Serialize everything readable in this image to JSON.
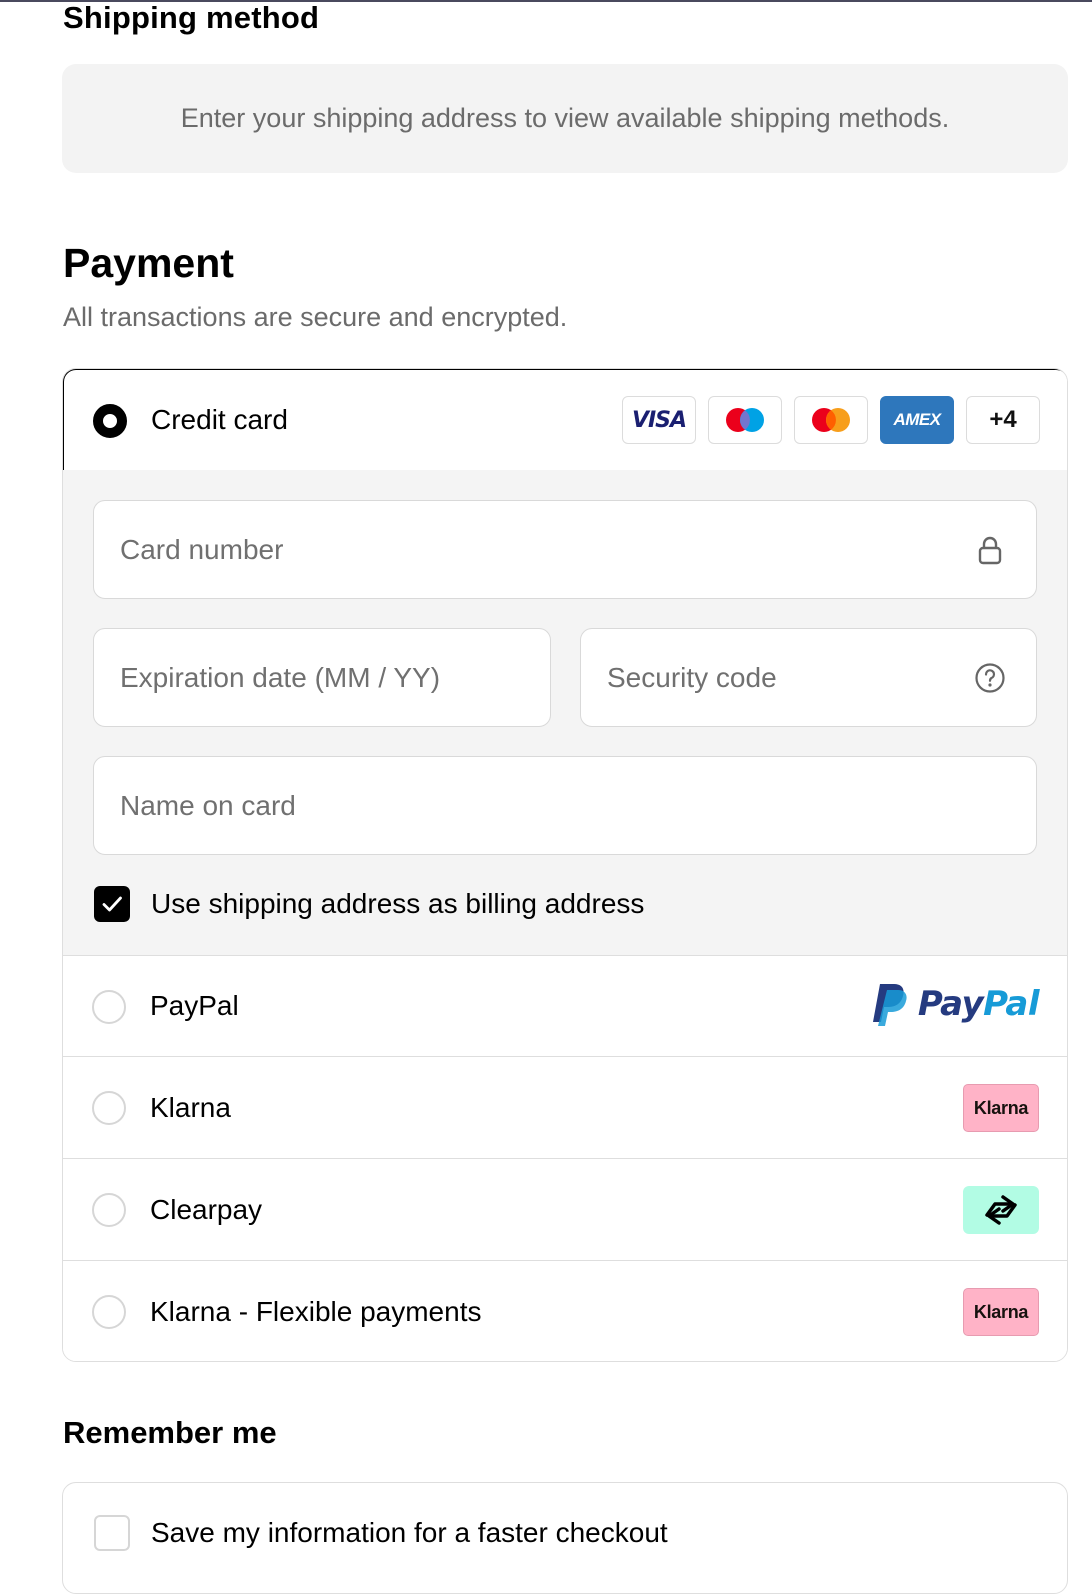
{
  "shipping": {
    "title": "Shipping method",
    "notice": "Enter your shipping address to view available shipping methods."
  },
  "payment": {
    "title": "Payment",
    "subtitle": "All transactions are secure and encrypted.",
    "credit_card": {
      "label": "Credit card",
      "selected": true,
      "card_brands": [
        "VISA",
        "Maestro",
        "Mastercard",
        "AMEX"
      ],
      "visa_text": "VISA",
      "amex_text": "AMEX",
      "more_brands": "+4",
      "fields": {
        "card_number_placeholder": "Card number",
        "expiration_placeholder": "Expiration date (MM / YY)",
        "security_code_placeholder": "Security code",
        "name_on_card_placeholder": "Name on card"
      },
      "billing_same_label": "Use shipping address as billing address",
      "billing_same_checked": true
    },
    "options": [
      {
        "label": "PayPal",
        "logo": "paypal-logo",
        "logo_text_pay": "Pay",
        "logo_text_pal": "Pal"
      },
      {
        "label": "Klarna",
        "logo": "klarna-logo",
        "logo_text": "Klarna"
      },
      {
        "label": "Clearpay",
        "logo": "clearpay-logo"
      },
      {
        "label": "Klarna - Flexible payments",
        "logo": "klarna-logo",
        "logo_text": "Klarna"
      }
    ]
  },
  "remember": {
    "title": "Remember me",
    "save_label": "Save my information for a faster checkout",
    "checked": false
  },
  "colors": {
    "panel_bg": "#f4f4f4",
    "border": "#dedede",
    "accent": "#000000",
    "muted_text": "#6b6b6b",
    "paypal_dark": "#253b80",
    "paypal_light": "#179bd7",
    "klarna_pink": "#ffb3c7",
    "clearpay_mint": "#b2fce4",
    "amex_blue": "#2e77bc"
  }
}
